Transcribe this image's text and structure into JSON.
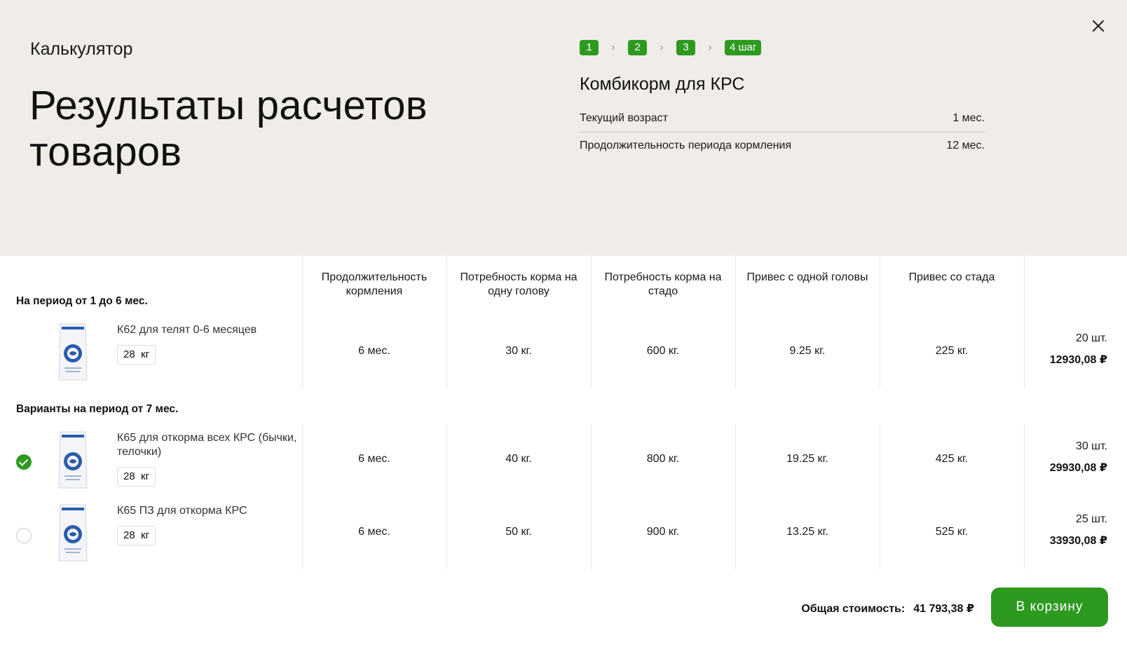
{
  "header": {
    "kicker": "Калькулятор",
    "title": "Результаты расчетов товаров",
    "steps": [
      "1",
      "2",
      "3",
      "4 шаг"
    ],
    "product_title": "Комбикорм для КРС",
    "params": [
      {
        "label": "Текущий возраст",
        "value": "1 мес."
      },
      {
        "label": "Продолжительность периода кормления",
        "value": "12 мес."
      }
    ]
  },
  "table": {
    "columns": [
      "Продолжительность кормления",
      "Потребность корма на одну голову",
      "Потребность корма на стадо",
      "Привес с одной головы",
      "Привес со стада"
    ],
    "group1_label": "На период от 1 до 6 мес.",
    "group2_label": "Варианты на период от 7 мес.",
    "rows": [
      {
        "name": "К62 для телят 0-6 месяцев",
        "weight": "28  кг",
        "duration": "6 мес.",
        "per_head": "30 кг.",
        "herd": "600 кг.",
        "gain_head": "9.25 кг.",
        "gain_herd": "225 кг.",
        "qty": "20 шт.",
        "price": "12930,08 ₽"
      },
      {
        "name": "К65 для откорма всех КРС (бычки, телочки)",
        "weight": "28  кг",
        "duration": "6 мес.",
        "per_head": "40 кг.",
        "herd": "800 кг.",
        "gain_head": "19.25 кг.",
        "gain_herd": "425 кг.",
        "qty": "30 шт.",
        "price": "29930,08 ₽",
        "selected": true
      },
      {
        "name": "К65 ПЗ для откорма КРС",
        "weight": "28  кг",
        "duration": "6 мес.",
        "per_head": "50 кг.",
        "herd": "900 кг.",
        "gain_head": "13.25 кг.",
        "gain_herd": "525 кг.",
        "qty": "25 шт.",
        "price": "33930,08 ₽",
        "selected": false
      }
    ]
  },
  "footer": {
    "total_label": "Общая стоимость:",
    "total_value": "41 793,38 ₽",
    "cart_button": "В  корзину"
  },
  "colors": {
    "accent": "#2d9a1f",
    "header_bg": "#f0ece8",
    "bag_blue": "#2a5db0"
  }
}
